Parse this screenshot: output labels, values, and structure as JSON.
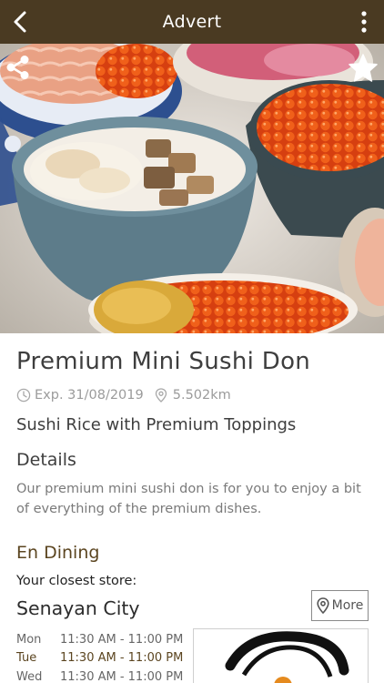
{
  "header": {
    "title": "Advert"
  },
  "deal": {
    "title": "Premium Mini Sushi Don",
    "expiry": "Exp. 31/08/2019",
    "distance": "5.502km",
    "subtitle": "Sushi Rice with Premium Toppings",
    "details_heading": "Details",
    "details_text": "Our premium mini sushi don is for you to enjoy a bit of everything of the premium dishes."
  },
  "merchant": {
    "name": "En Dining",
    "closest_label": "Your closest store:",
    "store_name": "Senayan City",
    "more_label": "More",
    "hours": [
      {
        "day": "Mon",
        "time": "11:30 AM - 11:00 PM"
      },
      {
        "day": "Tue",
        "time": "11:30 AM - 11:00 PM"
      },
      {
        "day": "Wed",
        "time": "11:30 AM - 11:00 PM"
      }
    ]
  },
  "colors": {
    "header_bg": "#4a3a22",
    "accent_brown": "#5b4520",
    "muted_text": "#9b9b9b"
  },
  "icons": [
    "back-icon",
    "kebab-menu-icon",
    "share-icon",
    "star-icon",
    "clock-icon",
    "location-pin-icon"
  ]
}
